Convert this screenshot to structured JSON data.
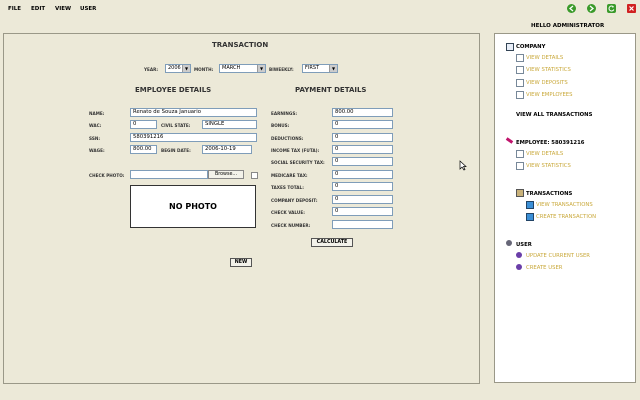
{
  "menu": [
    "FILE",
    "EDIT",
    "VIEW",
    "USER"
  ],
  "nav_icons": [
    "back-icon",
    "forward-icon",
    "refresh-icon",
    "close-icon"
  ],
  "greeting": "HELLO ADMINISTRATOR",
  "transaction": {
    "title": "TRANSACTION",
    "year_label": "YEAR:",
    "year_value": "2006",
    "month_label": "MONTH:",
    "month_value": "MARCH",
    "biweekly_label": "BIWEEKLY:",
    "biweekly_value": "FIRST"
  },
  "employee": {
    "heading": "EMPLOYEE DETAILS",
    "name_label": "NAME:",
    "name_value": "Renato de Souza Januario",
    "wac_label": "WAC:",
    "wac_value": "0",
    "civil_state_label": "CIVIL STATE:",
    "civil_state_value": "SINGLE",
    "ssn_label": "SSN:",
    "ssn_value": "580391216",
    "wage_label": "WAGE:",
    "wage_value": "800.00",
    "begin_date_label": "BEGIN DATE:",
    "begin_date_value": "2006-10-19",
    "check_photo_label": "CHECK PHOTO:",
    "browse_label": "Browse...",
    "no_photo": "NO PHOTO",
    "new_button": "NEW"
  },
  "payment": {
    "heading": "PAYMENT DETAILS",
    "fields": [
      {
        "label": "EARNINGS:",
        "value": "800.00"
      },
      {
        "label": "BONUS:",
        "value": "0"
      },
      {
        "label": "DEDUCTIONS:",
        "value": "0"
      },
      {
        "label": "INCOME TAX (FUTA):",
        "value": "0"
      },
      {
        "label": "SOCIAL SECURITY TAX:",
        "value": "0"
      },
      {
        "label": "MEDICARE TAX:",
        "value": "0"
      },
      {
        "label": "TAXES TOTAL:",
        "value": "0"
      },
      {
        "label": "COMPANY DEPOSIT:",
        "value": "0"
      },
      {
        "label": "CHECK VALUE:",
        "value": "0"
      },
      {
        "label": "CHECK NUMBER:",
        "value": ""
      }
    ],
    "calculate_button": "CALCULATE"
  },
  "sidebar": {
    "company": {
      "heading": "COMPANY",
      "links": [
        "VIEW DETAILS",
        "VIEW STATISTICS",
        "VIEW DEPOSITS",
        "VIEW EMPLOYEES"
      ]
    },
    "view_all_transactions": "VIEW ALL TRANSACTIONS",
    "employee": {
      "heading": "EMPLOYEE: 580391216",
      "links": [
        "VIEW DETAILS",
        "VIEW STATISTICS"
      ]
    },
    "transactions": {
      "heading": "TRANSACTIONS",
      "links": [
        "VIEW TRANSACTIONS",
        "CREATE TRANSACTION"
      ]
    },
    "user": {
      "heading": "USER",
      "links": [
        "UPDATE CURRENT USER",
        "CREATE USER"
      ]
    }
  }
}
